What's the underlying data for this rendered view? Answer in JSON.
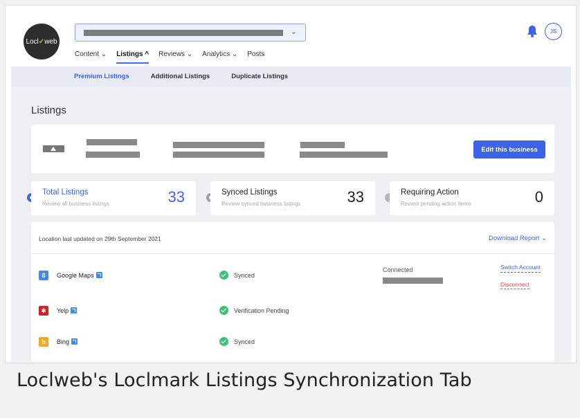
{
  "logo": {
    "text_prefix": "Locl",
    "text_mark": "✓",
    "text_suffix": "web"
  },
  "header": {
    "nav": [
      {
        "label": "Content ⌄"
      },
      {
        "label": "Listings ^"
      },
      {
        "label": "Reviews ⌄"
      },
      {
        "label": "Analytics ⌄"
      },
      {
        "label": "Posts"
      }
    ],
    "avatar_initials": "JS"
  },
  "subnav": [
    "Premium Listings",
    "Additional Listings",
    "Duplicate Listings"
  ],
  "page": {
    "title": "Listings",
    "edit_button": "Edit this business"
  },
  "stats": [
    {
      "title": "Total Listings",
      "subtitle": "Review all business listings",
      "value": "33"
    },
    {
      "title": "Synced Listings",
      "subtitle": "Review synced business listings",
      "value": "33"
    },
    {
      "title": "Requiring Action",
      "subtitle": "Review pending action items",
      "value": "0"
    }
  ],
  "table": {
    "updated": "Location last updated on 29th September 2021",
    "download": "Download Report ⌄",
    "rows": [
      {
        "icon": "google-maps-icon",
        "icon_glyph": "8",
        "icon_color": "#4a86e8",
        "name": "Google Maps",
        "status": "Synced",
        "connected": "Connected",
        "action1": "Switch Account",
        "action2": "Disconnect"
      },
      {
        "icon": "yelp-icon",
        "icon_glyph": "✱",
        "icon_color": "#d32323",
        "name": "Yelp",
        "status": "Verification Pending"
      },
      {
        "icon": "bing-icon",
        "icon_glyph": "b",
        "icon_color": "#f5a623",
        "name": "Bing",
        "status": "Synced"
      }
    ]
  },
  "caption": "Loclweb's Loclmark Listings Synchronization Tab",
  "colors": {
    "accent": "#3f63ea",
    "success": "#3fbf77",
    "danger": "#e04c4c"
  }
}
